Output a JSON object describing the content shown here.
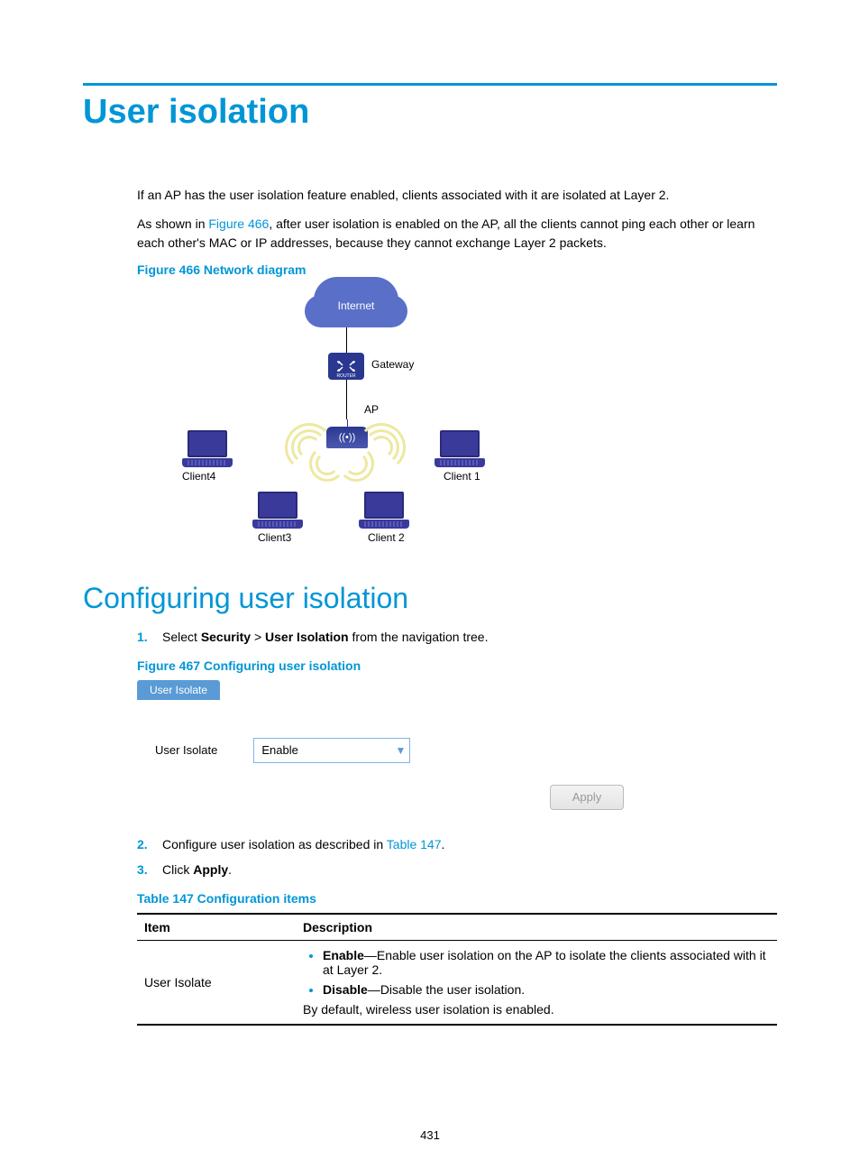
{
  "title": "User isolation",
  "intro1": "If an AP has the user isolation feature enabled, clients associated with it are isolated at Layer 2.",
  "intro2_a": "As shown in ",
  "intro2_link": "Figure 466",
  "intro2_b": ", after user isolation is enabled on the AP, all the clients cannot ping each other or learn each other's MAC or IP addresses, because they cannot exchange Layer 2 packets.",
  "figure466_caption": "Figure 466 Network diagram",
  "diagram": {
    "cloud": "Internet",
    "gateway": "Gateway",
    "ap": "AP",
    "ap_inner": "((•))",
    "client1": "Client 1",
    "client2": "Client 2",
    "client3": "Client3",
    "client4": "Client4"
  },
  "section2": "Configuring user isolation",
  "steps": {
    "s1_a": "Select ",
    "s1_security": "Security",
    "s1_gt": " > ",
    "s1_ui": "User Isolation",
    "s1_b": " from the navigation tree.",
    "s2_a": "Configure user isolation as described in ",
    "s2_link": "Table 147",
    "s2_b": ".",
    "s3_a": "Click ",
    "s3_apply": "Apply",
    "s3_b": "."
  },
  "figure467_caption": "Figure 467 Configuring user isolation",
  "ui": {
    "tab": "User Isolate",
    "label": "User Isolate",
    "select_value": "Enable",
    "apply": "Apply"
  },
  "table147_caption": "Table 147 Configuration items",
  "table": {
    "h_item": "Item",
    "h_desc": "Description",
    "row_item": "User Isolate",
    "enable_b": "Enable",
    "enable_t": "—Enable user isolation on the AP to isolate the clients associated with it at Layer 2.",
    "disable_b": "Disable",
    "disable_t": "—Disable the user isolation.",
    "default_t": "By default, wireless user isolation is enabled."
  },
  "page_number": "431"
}
